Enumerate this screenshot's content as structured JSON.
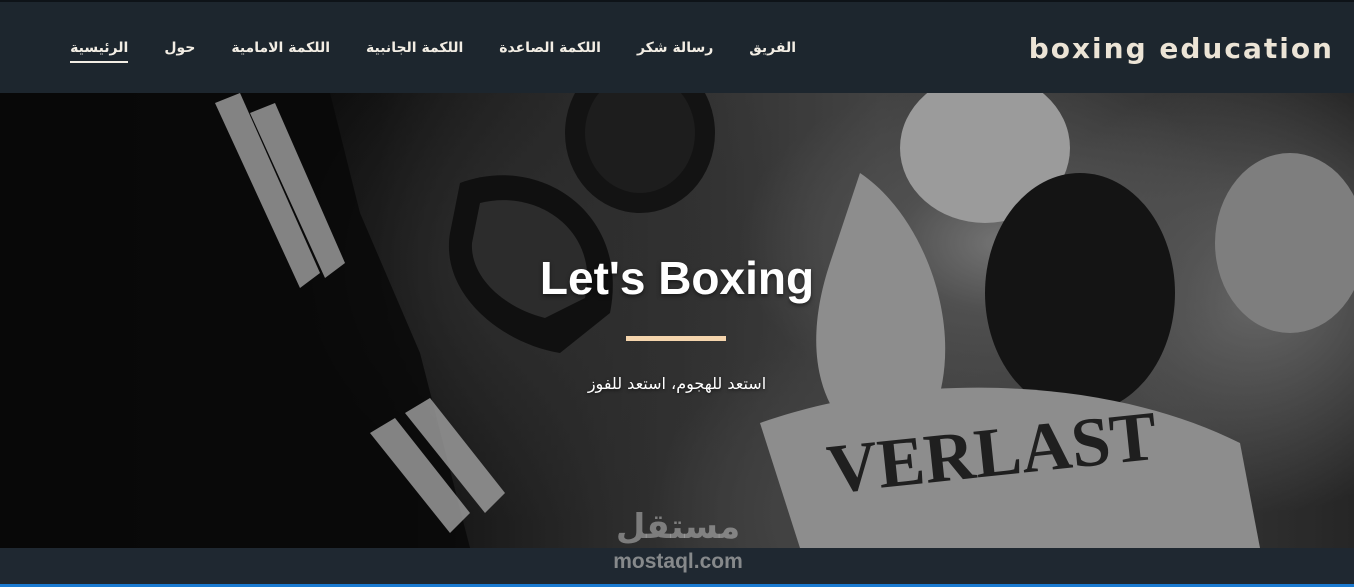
{
  "header": {
    "brand": "boxing education",
    "nav": [
      {
        "label": "الرئيسية",
        "active": true
      },
      {
        "label": "حول"
      },
      {
        "label": "اللكمة الامامية"
      },
      {
        "label": "اللكمة الجانبية"
      },
      {
        "label": "اللكمة الصاعدة"
      },
      {
        "label": "رسالة شكر"
      },
      {
        "label": "الفريق"
      }
    ]
  },
  "hero": {
    "title": "Let's Boxing",
    "subtitle": "استعد للهجوم، استعد للفوز",
    "image": "black-and-white boxing sparring photo",
    "accent_color": "#f5d5ad"
  },
  "watermark": {
    "arabic": "مستقل",
    "latin": "mostaql.com"
  },
  "colors": {
    "header_bg": "#1d262e",
    "brand_text": "#ece4d6",
    "bottom_border": "#1a7ad1"
  }
}
